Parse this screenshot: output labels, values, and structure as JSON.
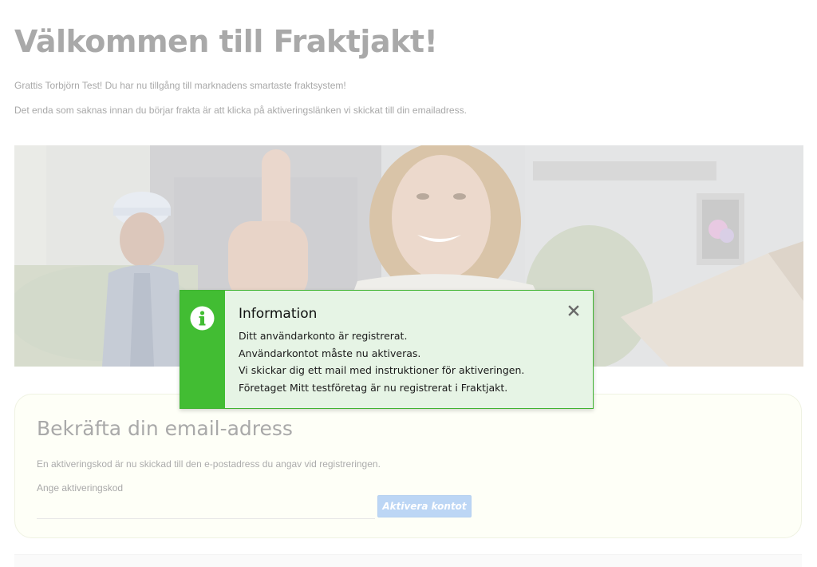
{
  "welcome": {
    "title": "Välkommen till Fraktjakt!",
    "congrats": "Grattis Torbjörn Test! Du har nu tillgång till marknadens smartaste fraktsystem!",
    "activation_note": "Det enda som saknas innan du börjar frakta är att klicka på aktiveringslänken vi skickat till din emailadress."
  },
  "confirm": {
    "title": "Bekräfta din email-adress",
    "text": "En aktiveringskod är nu skickad till den e-postadress du angav vid registreringen.",
    "code_label": "Ange aktiveringskod",
    "code_value": "",
    "activate_label": "Aktivera kontot"
  },
  "dialog": {
    "title": "Information",
    "lines": [
      "Ditt användarkonto är registrerat.",
      "Användarkontot måste nu aktiveras.",
      "Vi skickar dig ett mail med instruktioner för aktiveringen.",
      "Företaget Mitt testföretag är nu registrerat i Fraktjakt."
    ],
    "close_icon": "close-icon",
    "info_icon": "info-icon",
    "accent_color": "#42bd33",
    "background_color": "#e6f4e5"
  },
  "colors": {
    "activate_button": "#bcd6f5",
    "faded_text": "#a9a9a9"
  }
}
